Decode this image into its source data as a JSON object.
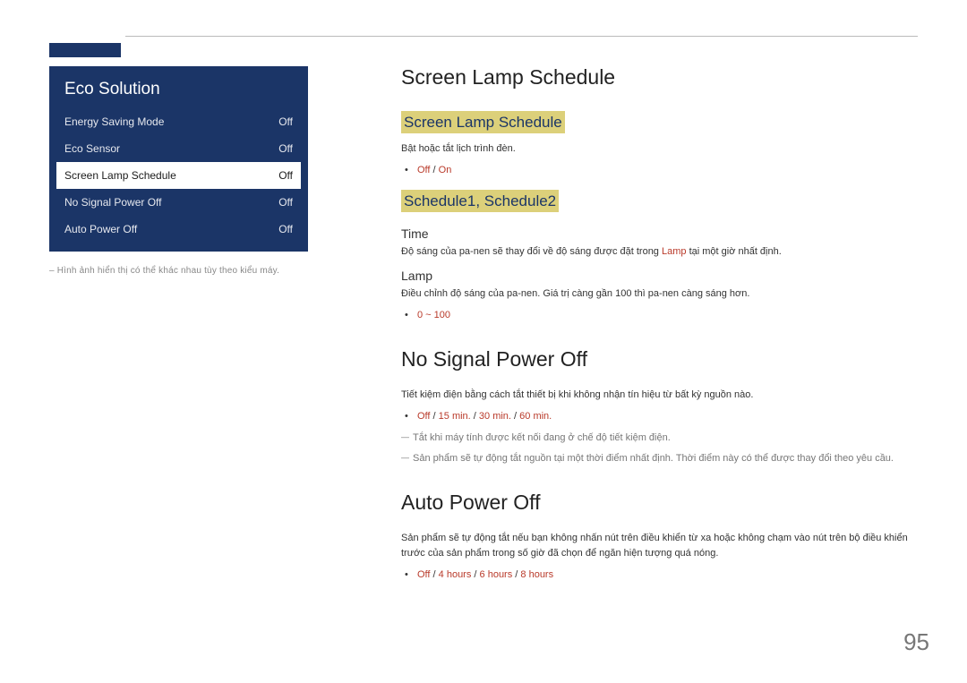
{
  "page_number": "95",
  "panel": {
    "title": "Eco Solution",
    "items": [
      {
        "label": "Energy Saving Mode",
        "value": "Off",
        "selected": false
      },
      {
        "label": "Eco Sensor",
        "value": "Off",
        "selected": false
      },
      {
        "label": "Screen Lamp Schedule",
        "value": "Off",
        "selected": true
      },
      {
        "label": "No Signal Power Off",
        "value": "Off",
        "selected": false
      },
      {
        "label": "Auto Power Off",
        "value": "Off",
        "selected": false
      }
    ],
    "footnote": "– Hình ảnh hiển thị có thể khác nhau tùy theo kiểu máy."
  },
  "section1": {
    "title": "Screen Lamp Schedule",
    "highlight1": "Screen Lamp Schedule",
    "h1_desc": "Bật hoặc tắt lịch trình đèn.",
    "h1_opt_off": "Off",
    "h1_opt_sep": " / ",
    "h1_opt_on": "On",
    "highlight2": "Schedule1, Schedule2",
    "time_label": "Time",
    "time_desc_a": "Độ sáng của pa-nen sẽ thay đổi về độ sáng được đặt trong ",
    "time_desc_lamp": "Lamp",
    "time_desc_b": " tại một giờ nhất định.",
    "lamp_label": "Lamp",
    "lamp_desc": "Điều chỉnh độ sáng của pa-nen. Giá trị càng gần 100 thì pa-nen càng sáng hơn.",
    "lamp_range": "0 ~ 100"
  },
  "section2": {
    "title": "No Signal Power Off",
    "desc": "Tiết kiệm điện bằng cách tắt thiết bị khi không nhận tín hiệu từ bất kỳ nguồn nào.",
    "opt_off": "Off",
    "opt_sep": " / ",
    "opt_15": "15 min.",
    "opt_30": "30 min.",
    "opt_60": "60 min.",
    "note1": "Tắt khi máy tính được kết nối đang ở chế độ tiết kiệm điện.",
    "note2": "Sản phẩm sẽ tự động tắt nguồn tại một thời điểm nhất định. Thời điểm này có thể được thay đổi theo yêu cầu."
  },
  "section3": {
    "title": "Auto Power Off",
    "desc": "Sản phẩm sẽ tự động tắt nếu bạn không nhấn nút trên điều khiển từ xa hoặc không chạm vào nút trên bộ điều khiển trước của sản phẩm trong số giờ đã chọn để ngăn hiện tượng quá nóng.",
    "opt_off": "Off",
    "opt_sep": " / ",
    "opt_4": "4 hours",
    "opt_6": "6 hours",
    "opt_8": "8 hours"
  }
}
